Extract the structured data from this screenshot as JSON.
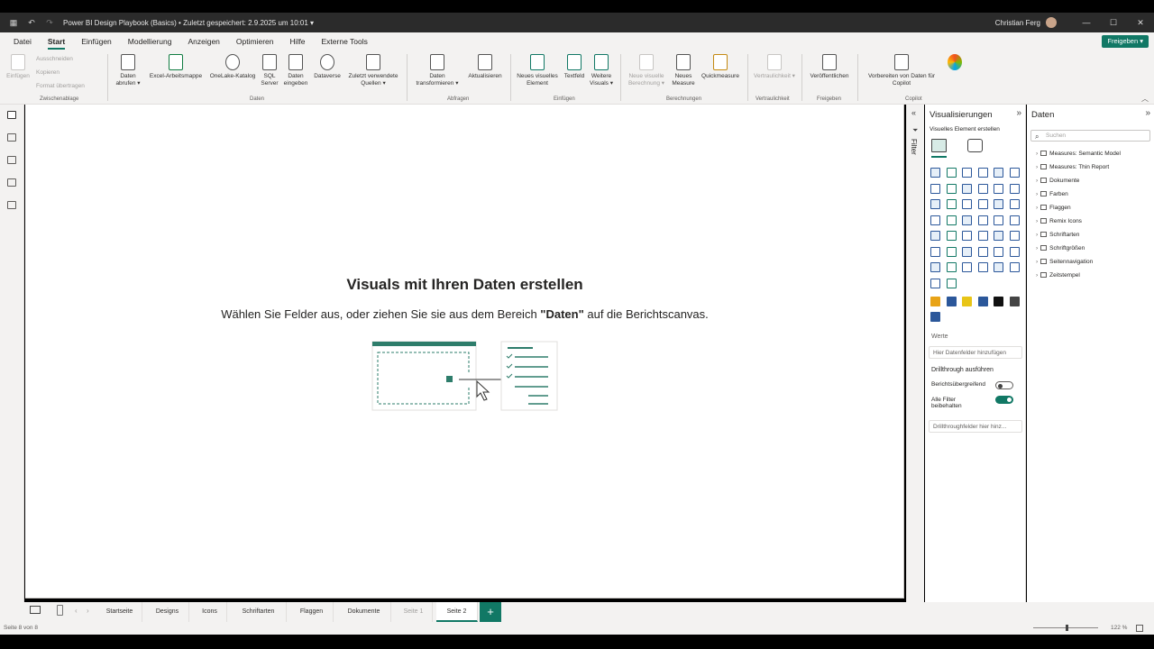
{
  "titlebar": {
    "title": "Power BI Design Playbook (Basics) • Zuletzt gespeichert: 2.9.2025 um 10:01 ▾",
    "user": "Christian Ferg",
    "minimize": "—",
    "maximize": "☐",
    "close": "✕"
  },
  "menu": {
    "tabs": [
      "Datei",
      "Start",
      "Einfügen",
      "Modellierung",
      "Anzeigen",
      "Optimieren",
      "Hilfe",
      "Externe Tools"
    ],
    "share": "Freigeben ▾"
  },
  "ribbon": {
    "paste": "Einfügen",
    "cut": "Ausschneiden",
    "copy": "Kopieren",
    "format_painter": "Format übertragen",
    "clipboard_group": "Zwischenablage",
    "get_data": "Daten abrufen ▾",
    "excel": "Excel-Arbeitsmappe",
    "onelake": "OneLake-Katalog",
    "sql": "SQL Server",
    "enter_data": "Daten eingeben",
    "dataverse": "Dataverse",
    "recent": "Zuletzt verwendete Quellen ▾",
    "data_group": "Daten",
    "transform": "Daten transformieren ▾",
    "refresh": "Aktualisieren",
    "queries_group": "Abfragen",
    "new_visual": "Neues visuelles Element",
    "textbox": "Textfeld",
    "more_visuals": "Weitere Visuals ▾",
    "insert_group": "Einfügen",
    "new_calc": "Neue visuelle Berechnung ▾",
    "new_measure": "Neues Measure",
    "quick_measure": "Quickmeasure",
    "calc_group": "Berechnungen",
    "sensitivity": "Vertraulichkeit ▾",
    "sensitivity_group": "Vertraulichkeit",
    "publish": "Veröffentlichen",
    "share_group": "Freigeben",
    "copilot": "Vorbereiten von Daten für Copilot",
    "copilot_btn": "Copilot",
    "copilot_group": "Copilot"
  },
  "canvas": {
    "title": "Visuals mit Ihren Daten erstellen",
    "subtitle_pre": "Wählen Sie Felder aus, oder ziehen Sie sie aus dem Bereich ",
    "subtitle_bold": "\"Daten\"",
    "subtitle_post": " auf die Berichtscanvas."
  },
  "filter": {
    "label": "Filter"
  },
  "visualizations": {
    "title": "Visualisierungen",
    "build_label": "Visuelles Element erstellen",
    "values_label": "Werte",
    "values_placeholder": "Hier Datenfelder hinzufügen",
    "drillthrough_label": "Drillthrough ausführen",
    "cross_report": "Berichtsübergreifend",
    "keep_filters": "Alle Filter beibehalten",
    "drillthrough_placeholder": "Drillthroughfelder hier hinz..."
  },
  "data_pane": {
    "title": "Daten",
    "search_placeholder": "Suchen",
    "items": [
      "Measures: Semantic Model",
      "Measures: Thin Report",
      "Dokumente",
      "Farben",
      "Flaggen",
      "Remix Icons",
      "Schriftarten",
      "Schriftgrößen",
      "Seitennavigation",
      "Zeitstempel"
    ]
  },
  "pages": {
    "tabs": [
      "Startseite",
      "Designs",
      "Icons",
      "Schriftarten",
      "Flaggen",
      "Dokumente",
      "Seite 1",
      "Seite 2"
    ],
    "active_index": 7,
    "add": "+"
  },
  "status": {
    "page_info": "Seite 8 von 8",
    "zoom": "122 %"
  },
  "colors": {
    "accent": "#117865",
    "ribbon_bg": "#f3f2f1",
    "titlebar_bg": "#2b2b2b"
  }
}
